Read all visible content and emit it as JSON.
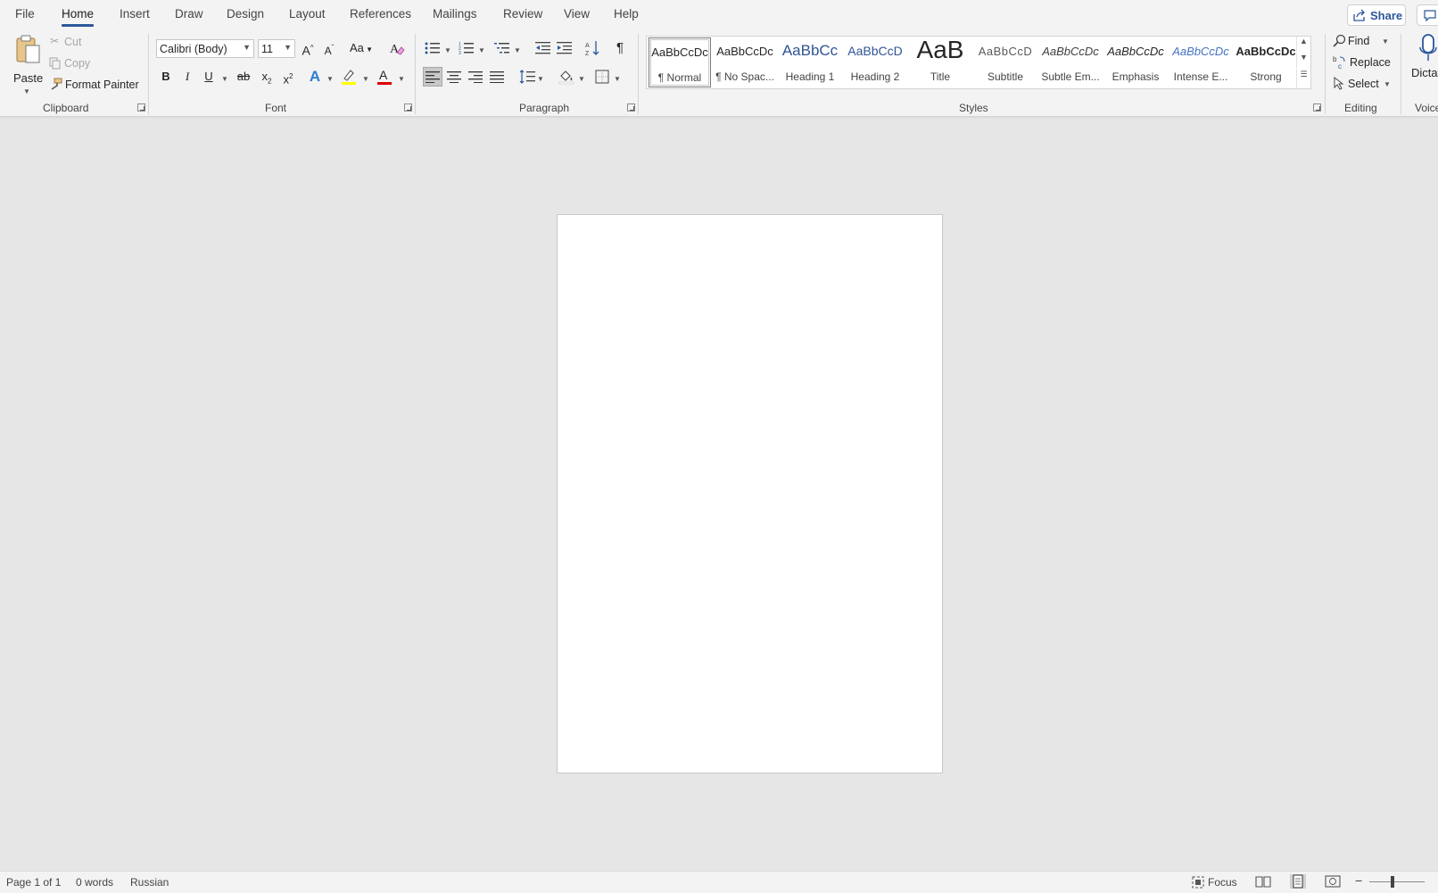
{
  "tabs": {
    "file": "File",
    "home": "Home",
    "insert": "Insert",
    "draw": "Draw",
    "design": "Design",
    "layout": "Layout",
    "references": "References",
    "mailings": "Mailings",
    "review": "Review",
    "view": "View",
    "help": "Help",
    "share": "Share"
  },
  "clipboard": {
    "paste": "Paste",
    "cut": "Cut",
    "copy": "Copy",
    "format_painter": "Format Painter",
    "label": "Clipboard"
  },
  "font": {
    "name": "Calibri (Body)",
    "size": "11",
    "label": "Font",
    "grow": "A",
    "shrink": "A",
    "change_case": "Aa",
    "bold": "B",
    "italic": "I",
    "underline": "U",
    "strikethrough": "ab",
    "subscript": "x",
    "superscript": "x",
    "text_effects": "A",
    "font_color": "A",
    "highlight_color": "#ffff00",
    "font_color_value": "#e00000"
  },
  "paragraph": {
    "label": "Paragraph",
    "show_marks": "¶"
  },
  "styles": {
    "label": "Styles",
    "items": [
      {
        "sample": "AaBbCcDc",
        "name": "¶ Normal"
      },
      {
        "sample": "AaBbCcDc",
        "name": "¶ No Spac..."
      },
      {
        "sample": "AaBbCc",
        "name": "Heading 1"
      },
      {
        "sample": "AaBbCcD",
        "name": "Heading 2"
      },
      {
        "sample": "AaB",
        "name": "Title"
      },
      {
        "sample": "AaBbCcD",
        "name": "Subtitle"
      },
      {
        "sample": "AaBbCcDc",
        "name": "Subtle Em..."
      },
      {
        "sample": "AaBbCcDc",
        "name": "Emphasis"
      },
      {
        "sample": "AaBbCcDc",
        "name": "Intense E..."
      },
      {
        "sample": "AaBbCcDc",
        "name": "Strong"
      }
    ]
  },
  "editing": {
    "label": "Editing",
    "find": "Find",
    "replace": "Replace",
    "select": "Select"
  },
  "voice": {
    "label": "Voice",
    "dictate": "Dictat"
  },
  "status": {
    "page": "Page 1 of 1",
    "words": "0 words",
    "language": "Russian",
    "focus": "Focus"
  },
  "colors": {
    "accent": "#2b579a",
    "heading_blue": "#2f5496"
  }
}
